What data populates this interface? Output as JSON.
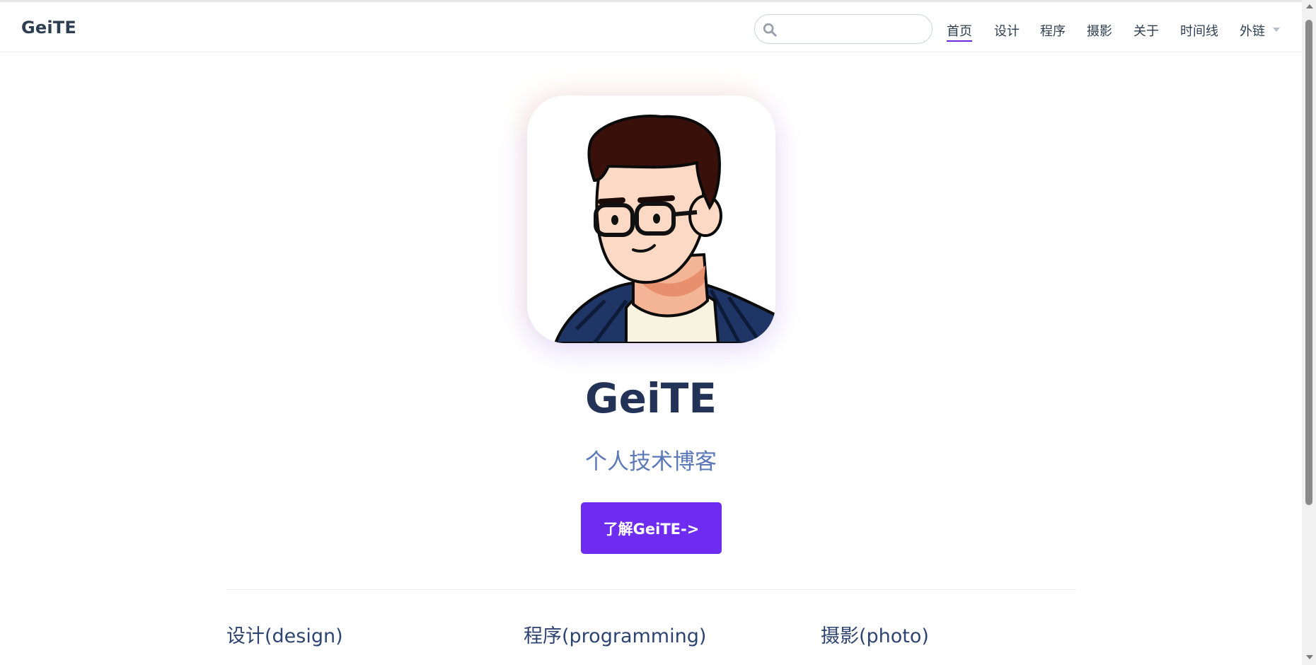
{
  "header": {
    "brand": "GeiTE",
    "search": {
      "value": "",
      "placeholder": ""
    },
    "nav": [
      {
        "label": "首页",
        "active": true
      },
      {
        "label": "设计",
        "active": false
      },
      {
        "label": "程序",
        "active": false
      },
      {
        "label": "摄影",
        "active": false
      },
      {
        "label": "关于",
        "active": false
      },
      {
        "label": "时间线",
        "active": false
      },
      {
        "label": "外链",
        "active": false,
        "has_dropdown": true
      }
    ]
  },
  "hero": {
    "image_alt_icon": "avatar-illustration",
    "title": "GeiTE",
    "subtitle": "个人技术博客",
    "cta_label": "了解GeiTE->"
  },
  "features": [
    {
      "title": "设计(design)"
    },
    {
      "title": "程序(programming)"
    },
    {
      "title": "摄影(photo)"
    }
  ],
  "colors": {
    "accent": "#6d2cf0",
    "title": "#233257",
    "subtitle": "#5b78b8"
  }
}
